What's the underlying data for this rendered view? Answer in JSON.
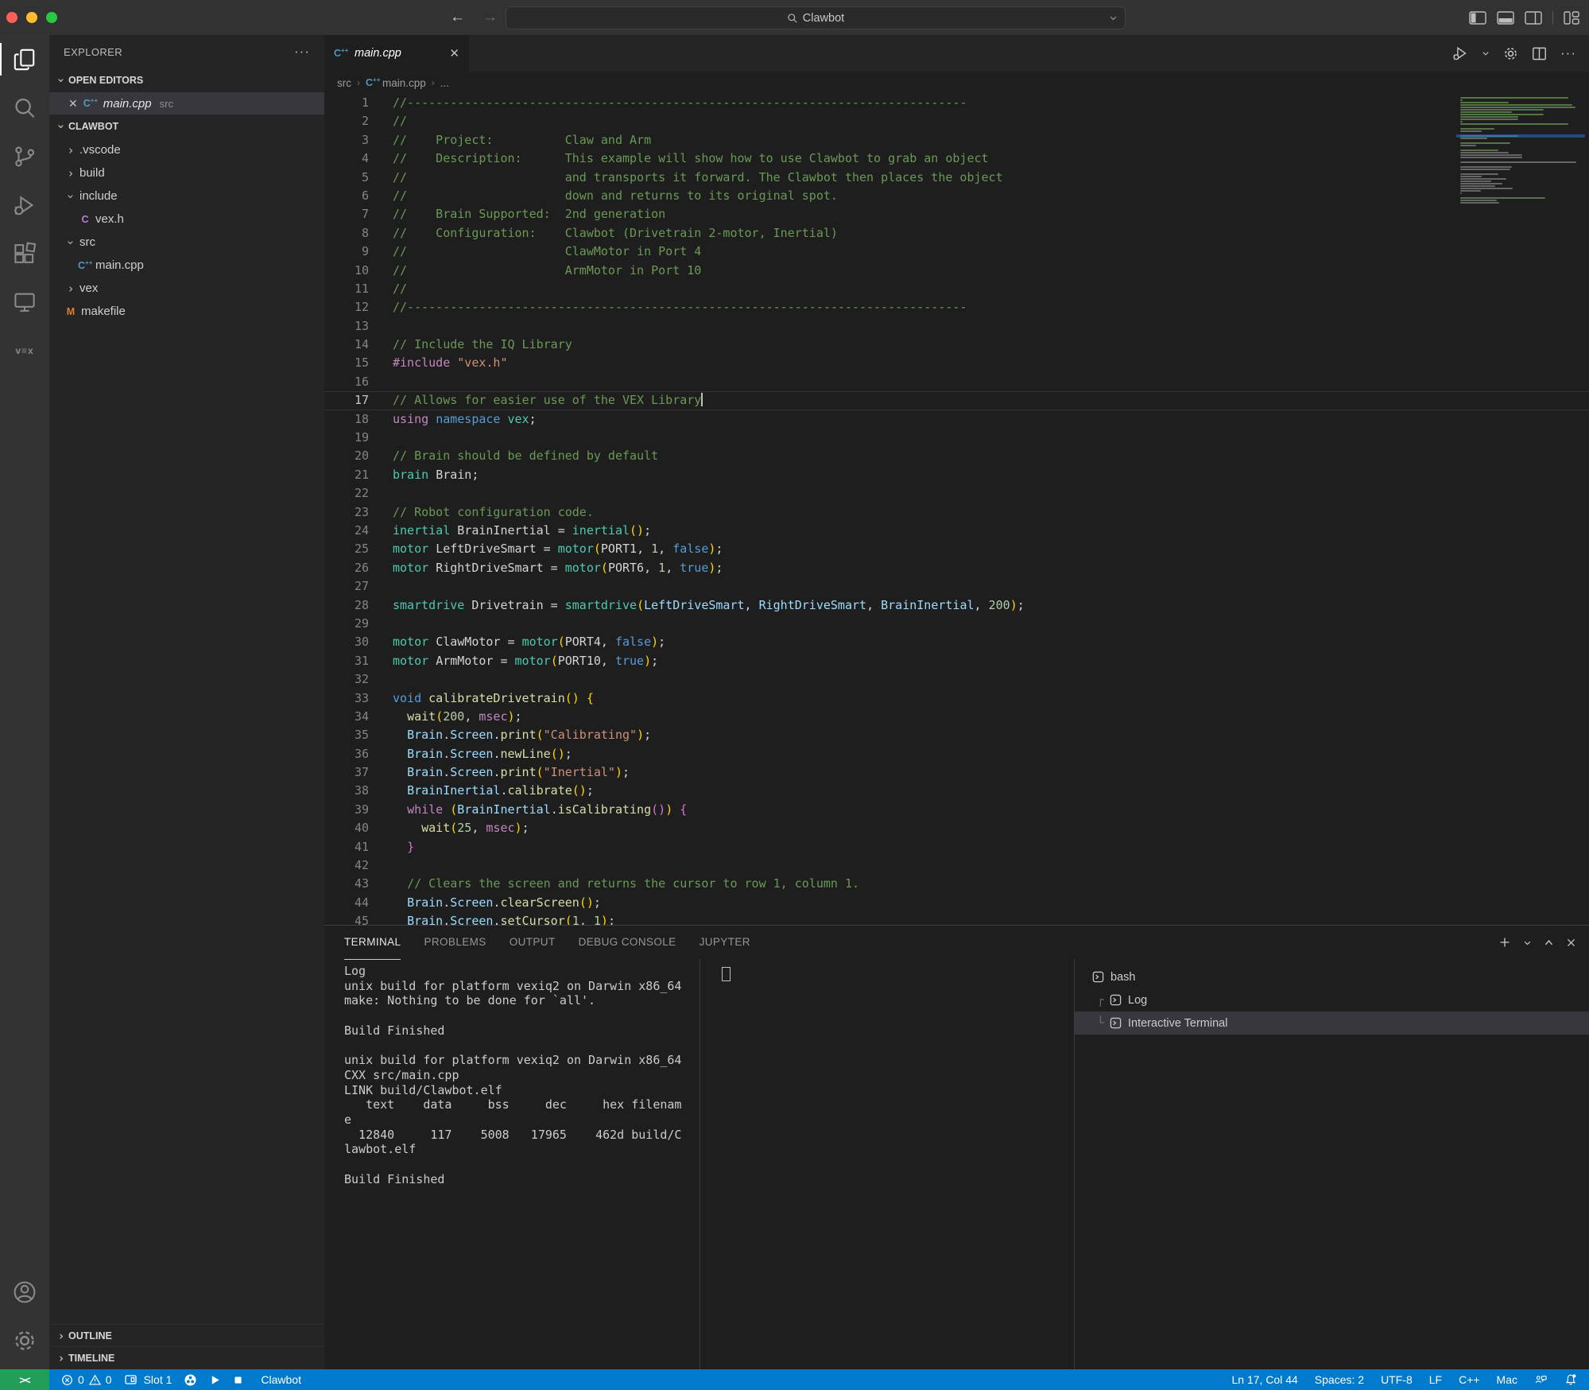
{
  "window": {
    "search_value": "Clawbot"
  },
  "activity_bar": {
    "items": [
      "explorer",
      "search",
      "source-control",
      "run-and-debug",
      "extensions",
      "remote-explorer",
      "vex"
    ],
    "bottom_items": [
      "accounts",
      "settings"
    ]
  },
  "sidebar": {
    "title": "EXPLORER",
    "open_editors": {
      "header": "OPEN EDITORS",
      "file": "main.cpp",
      "detail": "src"
    },
    "project": {
      "header": "CLAWBOT"
    },
    "tree": [
      {
        "label": ".vscode",
        "chevron": "closed",
        "depth": 0
      },
      {
        "label": "build",
        "chevron": "closed",
        "depth": 0
      },
      {
        "label": "include",
        "chevron": "open",
        "depth": 0
      },
      {
        "label": "vex.h",
        "icon": "c",
        "depth": 1
      },
      {
        "label": "src",
        "chevron": "open",
        "depth": 0
      },
      {
        "label": "main.cpp",
        "icon": "cpp",
        "depth": 1
      },
      {
        "label": "vex",
        "chevron": "closed",
        "depth": 0
      },
      {
        "label": "makefile",
        "icon": "m",
        "depth": 0
      }
    ],
    "outline": "OUTLINE",
    "timeline": "TIMELINE"
  },
  "editor": {
    "tab": {
      "label": "main.cpp"
    },
    "breadcrumb": {
      "folder": "src",
      "file": "main.cpp",
      "more": "..."
    },
    "active_line": 17,
    "colors": {
      "cm": "#6A9955",
      "kw": "#C586C0",
      "kb": "#569CD6",
      "ty": "#4EC9B0",
      "id": "#D4D4D4",
      "vr": "#9CDCFE",
      "fn": "#DCDCAA",
      "nm": "#B5CEA8",
      "st": "#CE9178",
      "pn": "#D4D4D4",
      "br": "#FFD700",
      "b2": "#DA70D6"
    },
    "code_lines": [
      {
        "n": 1,
        "s": [
          [
            "cm",
            "//------------------------------------------------------------------------------"
          ]
        ]
      },
      {
        "n": 2,
        "s": [
          [
            "cm",
            "//"
          ]
        ]
      },
      {
        "n": 3,
        "s": [
          [
            "cm",
            "//    Project:          Claw and Arm"
          ]
        ]
      },
      {
        "n": 4,
        "s": [
          [
            "cm",
            "//    Description:      This example will show how to use Clawbot to grab an object"
          ]
        ]
      },
      {
        "n": 5,
        "s": [
          [
            "cm",
            "//                      and transports it forward. The Clawbot then places the object"
          ]
        ]
      },
      {
        "n": 6,
        "s": [
          [
            "cm",
            "//                      down and returns to its original spot."
          ]
        ]
      },
      {
        "n": 7,
        "s": [
          [
            "cm",
            "//    Brain Supported:  2nd generation"
          ]
        ]
      },
      {
        "n": 8,
        "s": [
          [
            "cm",
            "//    Configuration:    Clawbot (Drivetrain 2-motor, Inertial)"
          ]
        ]
      },
      {
        "n": 9,
        "s": [
          [
            "cm",
            "//                      ClawMotor in Port 4"
          ]
        ]
      },
      {
        "n": 10,
        "s": [
          [
            "cm",
            "//                      ArmMotor in Port 10"
          ]
        ]
      },
      {
        "n": 11,
        "s": [
          [
            "cm",
            "//"
          ]
        ]
      },
      {
        "n": 12,
        "s": [
          [
            "cm",
            "//------------------------------------------------------------------------------"
          ]
        ]
      },
      {
        "n": 13,
        "s": []
      },
      {
        "n": 14,
        "s": [
          [
            "cm",
            "// Include the IQ Library"
          ]
        ]
      },
      {
        "n": 15,
        "s": [
          [
            "kw",
            "#include"
          ],
          [
            "pn",
            " "
          ],
          [
            "st",
            "\"vex.h\""
          ]
        ]
      },
      {
        "n": 16,
        "s": []
      },
      {
        "n": 17,
        "s": [
          [
            "cm",
            "// Allows for easier use of the VEX Library"
          ]
        ]
      },
      {
        "n": 18,
        "s": [
          [
            "kw",
            "using"
          ],
          [
            "pn",
            " "
          ],
          [
            "kb",
            "namespace"
          ],
          [
            "pn",
            " "
          ],
          [
            "ty",
            "vex"
          ],
          [
            "pn",
            ";"
          ]
        ]
      },
      {
        "n": 19,
        "s": []
      },
      {
        "n": 20,
        "s": [
          [
            "cm",
            "// Brain should be defined by default"
          ]
        ]
      },
      {
        "n": 21,
        "s": [
          [
            "ty",
            "brain"
          ],
          [
            "pn",
            " "
          ],
          [
            "id",
            "Brain"
          ],
          [
            "pn",
            ";"
          ]
        ]
      },
      {
        "n": 22,
        "s": []
      },
      {
        "n": 23,
        "s": [
          [
            "cm",
            "// Robot configuration code."
          ]
        ]
      },
      {
        "n": 24,
        "s": [
          [
            "ty",
            "inertial"
          ],
          [
            "pn",
            " "
          ],
          [
            "id",
            "BrainInertial"
          ],
          [
            "pn",
            " = "
          ],
          [
            "ty",
            "inertial"
          ],
          [
            "br",
            "()"
          ],
          [
            "pn",
            ";"
          ]
        ]
      },
      {
        "n": 25,
        "s": [
          [
            "ty",
            "motor"
          ],
          [
            "pn",
            " "
          ],
          [
            "id",
            "LeftDriveSmart"
          ],
          [
            "pn",
            " = "
          ],
          [
            "ty",
            "motor"
          ],
          [
            "br",
            "("
          ],
          [
            "id",
            "PORT1"
          ],
          [
            "pn",
            ", "
          ],
          [
            "nm",
            "1"
          ],
          [
            "pn",
            ", "
          ],
          [
            "kb",
            "false"
          ],
          [
            "br",
            ")"
          ],
          [
            "pn",
            ";"
          ]
        ]
      },
      {
        "n": 26,
        "s": [
          [
            "ty",
            "motor"
          ],
          [
            "pn",
            " "
          ],
          [
            "id",
            "RightDriveSmart"
          ],
          [
            "pn",
            " = "
          ],
          [
            "ty",
            "motor"
          ],
          [
            "br",
            "("
          ],
          [
            "id",
            "PORT6"
          ],
          [
            "pn",
            ", "
          ],
          [
            "nm",
            "1"
          ],
          [
            "pn",
            ", "
          ],
          [
            "kb",
            "true"
          ],
          [
            "br",
            ")"
          ],
          [
            "pn",
            ";"
          ]
        ]
      },
      {
        "n": 27,
        "s": []
      },
      {
        "n": 28,
        "s": [
          [
            "ty",
            "smartdrive"
          ],
          [
            "pn",
            " "
          ],
          [
            "id",
            "Drivetrain"
          ],
          [
            "pn",
            " = "
          ],
          [
            "ty",
            "smartdrive"
          ],
          [
            "br",
            "("
          ],
          [
            "vr",
            "LeftDriveSmart"
          ],
          [
            "pn",
            ", "
          ],
          [
            "vr",
            "RightDriveSmart"
          ],
          [
            "pn",
            ", "
          ],
          [
            "vr",
            "BrainInertial"
          ],
          [
            "pn",
            ", "
          ],
          [
            "nm",
            "200"
          ],
          [
            "br",
            ")"
          ],
          [
            "pn",
            ";"
          ]
        ]
      },
      {
        "n": 29,
        "s": []
      },
      {
        "n": 30,
        "s": [
          [
            "ty",
            "motor"
          ],
          [
            "pn",
            " "
          ],
          [
            "id",
            "ClawMotor"
          ],
          [
            "pn",
            " = "
          ],
          [
            "ty",
            "motor"
          ],
          [
            "br",
            "("
          ],
          [
            "id",
            "PORT4"
          ],
          [
            "pn",
            ", "
          ],
          [
            "kb",
            "false"
          ],
          [
            "br",
            ")"
          ],
          [
            "pn",
            ";"
          ]
        ]
      },
      {
        "n": 31,
        "s": [
          [
            "ty",
            "motor"
          ],
          [
            "pn",
            " "
          ],
          [
            "id",
            "ArmMotor"
          ],
          [
            "pn",
            " = "
          ],
          [
            "ty",
            "motor"
          ],
          [
            "br",
            "("
          ],
          [
            "id",
            "PORT10"
          ],
          [
            "pn",
            ", "
          ],
          [
            "kb",
            "true"
          ],
          [
            "br",
            ")"
          ],
          [
            "pn",
            ";"
          ]
        ]
      },
      {
        "n": 32,
        "s": []
      },
      {
        "n": 33,
        "s": [
          [
            "kb",
            "void"
          ],
          [
            "pn",
            " "
          ],
          [
            "fn",
            "calibrateDrivetrain"
          ],
          [
            "br",
            "()"
          ],
          [
            "pn",
            " "
          ],
          [
            "br",
            "{"
          ]
        ]
      },
      {
        "n": 34,
        "s": [
          [
            "pn",
            "  "
          ],
          [
            "fn",
            "wait"
          ],
          [
            "br",
            "("
          ],
          [
            "nm",
            "200"
          ],
          [
            "pn",
            ", "
          ],
          [
            "kw",
            "msec"
          ],
          [
            "br",
            ")"
          ],
          [
            "pn",
            ";"
          ]
        ]
      },
      {
        "n": 35,
        "s": [
          [
            "pn",
            "  "
          ],
          [
            "vr",
            "Brain"
          ],
          [
            "pn",
            "."
          ],
          [
            "vr",
            "Screen"
          ],
          [
            "pn",
            "."
          ],
          [
            "fn",
            "print"
          ],
          [
            "br",
            "("
          ],
          [
            "st",
            "\"Calibrating\""
          ],
          [
            "br",
            ")"
          ],
          [
            "pn",
            ";"
          ]
        ]
      },
      {
        "n": 36,
        "s": [
          [
            "pn",
            "  "
          ],
          [
            "vr",
            "Brain"
          ],
          [
            "pn",
            "."
          ],
          [
            "vr",
            "Screen"
          ],
          [
            "pn",
            "."
          ],
          [
            "fn",
            "newLine"
          ],
          [
            "br",
            "()"
          ],
          [
            "pn",
            ";"
          ]
        ]
      },
      {
        "n": 37,
        "s": [
          [
            "pn",
            "  "
          ],
          [
            "vr",
            "Brain"
          ],
          [
            "pn",
            "."
          ],
          [
            "vr",
            "Screen"
          ],
          [
            "pn",
            "."
          ],
          [
            "fn",
            "print"
          ],
          [
            "br",
            "("
          ],
          [
            "st",
            "\"Inertial\""
          ],
          [
            "br",
            ")"
          ],
          [
            "pn",
            ";"
          ]
        ]
      },
      {
        "n": 38,
        "s": [
          [
            "pn",
            "  "
          ],
          [
            "vr",
            "BrainInertial"
          ],
          [
            "pn",
            "."
          ],
          [
            "fn",
            "calibrate"
          ],
          [
            "br",
            "()"
          ],
          [
            "pn",
            ";"
          ]
        ]
      },
      {
        "n": 39,
        "s": [
          [
            "pn",
            "  "
          ],
          [
            "kw",
            "while"
          ],
          [
            "pn",
            " "
          ],
          [
            "br",
            "("
          ],
          [
            "vr",
            "BrainInertial"
          ],
          [
            "pn",
            "."
          ],
          [
            "fn",
            "isCalibrating"
          ],
          [
            "b2",
            "()"
          ],
          [
            "br",
            ")"
          ],
          [
            "pn",
            " "
          ],
          [
            "b2",
            "{"
          ]
        ]
      },
      {
        "n": 40,
        "s": [
          [
            "pn",
            "    "
          ],
          [
            "fn",
            "wait"
          ],
          [
            "br",
            "("
          ],
          [
            "nm",
            "25"
          ],
          [
            "pn",
            ", "
          ],
          [
            "kw",
            "msec"
          ],
          [
            "br",
            ")"
          ],
          [
            "pn",
            ";"
          ]
        ]
      },
      {
        "n": 41,
        "s": [
          [
            "pn",
            "  "
          ],
          [
            "b2",
            "}"
          ]
        ]
      },
      {
        "n": 42,
        "s": []
      },
      {
        "n": 43,
        "s": [
          [
            "pn",
            "  "
          ],
          [
            "cm",
            "// Clears the screen and returns the cursor to row 1, column 1."
          ]
        ]
      },
      {
        "n": 44,
        "s": [
          [
            "pn",
            "  "
          ],
          [
            "vr",
            "Brain"
          ],
          [
            "pn",
            "."
          ],
          [
            "vr",
            "Screen"
          ],
          [
            "pn",
            "."
          ],
          [
            "fn",
            "clearScreen"
          ],
          [
            "br",
            "()"
          ],
          [
            "pn",
            ";"
          ]
        ]
      },
      {
        "n": 45,
        "s": [
          [
            "pn",
            "  "
          ],
          [
            "vr",
            "Brain"
          ],
          [
            "pn",
            "."
          ],
          [
            "vr",
            "Screen"
          ],
          [
            "pn",
            "."
          ],
          [
            "fn",
            "setCursor"
          ],
          [
            "br",
            "("
          ],
          [
            "nm",
            "1"
          ],
          [
            "pn",
            ", "
          ],
          [
            "nm",
            "1"
          ],
          [
            "br",
            ")"
          ],
          [
            "pn",
            ";"
          ]
        ]
      }
    ]
  },
  "panel": {
    "tabs": [
      "TERMINAL",
      "PROBLEMS",
      "OUTPUT",
      "DEBUG CONSOLE",
      "JUPYTER"
    ],
    "active_tab": "TERMINAL",
    "terminal_lines": [
      "Log",
      "unix build for platform vexiq2 on Darwin x86_64",
      "make: Nothing to be done for `all'.",
      "",
      "Build Finished",
      "",
      "unix build for platform vexiq2 on Darwin x86_64",
      "CXX src/main.cpp",
      "LINK build/Clawbot.elf",
      "   text    data     bss     dec     hex filenam",
      "e",
      "  12840     117    5008   17965    462d build/C",
      "lawbot.elf",
      "",
      "Build Finished"
    ],
    "terminals": [
      {
        "label": "bash",
        "guide": "",
        "selected": false
      },
      {
        "label": "Log",
        "guide": "┌",
        "selected": false
      },
      {
        "label": "Interactive Terminal",
        "guide": "└",
        "selected": true
      }
    ]
  },
  "statusbar": {
    "errors": "0",
    "warnings": "0",
    "slot": "Slot 1",
    "project": "Clawbot",
    "right": [
      "Ln 17, Col 44",
      "Spaces: 2",
      "UTF-8",
      "LF",
      "C++",
      "Mac"
    ]
  }
}
